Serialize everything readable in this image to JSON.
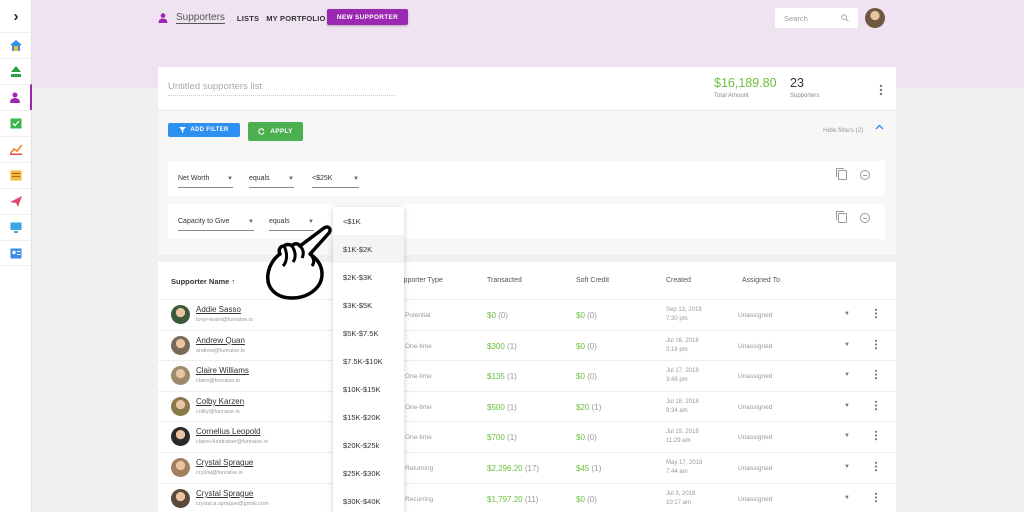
{
  "nav": {
    "supporters": "Supporters",
    "lists": "LISTS",
    "portfolio": "MY PORTFOLIO",
    "new_supporter": "NEW SUPPORTER",
    "search_placeholder": "Search"
  },
  "sidebar": {
    "icons": [
      "home-icon",
      "upload-icon",
      "supporters-icon",
      "tasks-icon",
      "trend-icon",
      "report-icon",
      "campaign-icon",
      "display-icon",
      "contacts-icon"
    ],
    "active": "supporters-icon"
  },
  "list": {
    "title_placeholder": "Untitled supporters list",
    "total_amount": "$16,189.80",
    "total_amount_label": "Total Amount",
    "supporters_count": "23",
    "supporters_label": "Supporters"
  },
  "filters": {
    "add_filter": "ADD FILTER",
    "apply": "APPLY",
    "hide_filters": "Hide filters (2)",
    "rows": [
      {
        "field": "Net Worth",
        "operator": "equals",
        "value": "<$25K"
      },
      {
        "field": "Capacity to Give",
        "operator": "equals",
        "value": ""
      }
    ]
  },
  "dropdown": {
    "options": [
      "<$1K",
      "$1K-$2K",
      "$2K-$3K",
      "$3K-$5K",
      "$5K-$7.5K",
      "$7.5K-$10K",
      "$10K-$15K",
      "$15K-$20K",
      "$20K-$25k",
      "$25K-$30K",
      "$30K-$40K"
    ],
    "highlighted_index": 1
  },
  "table": {
    "headers": {
      "name": "Supporter Name",
      "type": "Supporter Type",
      "transacted": "Transacted",
      "soft_credit": "Soft Credit",
      "created": "Created",
      "assigned": "Assigned To"
    },
    "rows": [
      {
        "name": "Addie Sasso",
        "email": "tony+team@funraise.io",
        "type": "Potential",
        "transacted": "$0",
        "transacted_count": "(0)",
        "soft_credit": "$0",
        "soft_count": "(0)",
        "date": "Sep 13, 2018",
        "time": "7:30 pm",
        "assigned": "Unassigned"
      },
      {
        "name": "Andrew Quan",
        "email": "andrew@funraise.io",
        "type": "One-time",
        "transacted": "$300",
        "transacted_count": "(1)",
        "soft_credit": "$0",
        "soft_count": "(0)",
        "date": "Jul 16, 2018",
        "time": "3:16 pm",
        "assigned": "Unassigned"
      },
      {
        "name": "Claire Williams",
        "email": "claire@funraise.io",
        "type": "One-time",
        "transacted": "$135",
        "transacted_count": "(1)",
        "soft_credit": "$0",
        "soft_count": "(0)",
        "date": "Jul 17, 2018",
        "time": "3:48 pm",
        "assigned": "Unassigned"
      },
      {
        "name": "Colby Karzen",
        "email": "colby@funraise.io",
        "type": "One-time",
        "transacted": "$500",
        "transacted_count": "(1)",
        "soft_credit": "$20",
        "soft_count": "(1)",
        "date": "Jul 18, 2018",
        "time": "9:34 am",
        "assigned": "Unassigned"
      },
      {
        "name": "Cornelius Leopold",
        "email": "claire+fundraiser@funraise.io",
        "type": "One-time",
        "transacted": "$700",
        "transacted_count": "(1)",
        "soft_credit": "$0",
        "soft_count": "(0)",
        "date": "Jul 19, 2018",
        "time": "11:29 am",
        "assigned": "Unassigned"
      },
      {
        "name": "Crystal Sprague",
        "email": "crystal@funraise.io",
        "type": "Returning",
        "transacted": "$2,296.20",
        "transacted_count": "(17)",
        "soft_credit": "$45",
        "soft_count": "(1)",
        "date": "May 17, 2018",
        "time": "7:44 am",
        "assigned": "Unassigned"
      },
      {
        "name": "Crystal Sprague",
        "email": "crystal.a.sprague@gmail.com",
        "type": "Recurring",
        "transacted": "$1,797.20",
        "transacted_count": "(11)",
        "soft_credit": "$0",
        "soft_count": "(0)",
        "date": "Jul 3, 2018",
        "time": "10:17 am",
        "assigned": "Unassigned"
      }
    ]
  },
  "colors": {
    "brand": "#9c27b0",
    "band": "#efe3f1",
    "money": "#6abf3b",
    "add_filter": "#2d8ff0",
    "apply": "#4caf50"
  }
}
